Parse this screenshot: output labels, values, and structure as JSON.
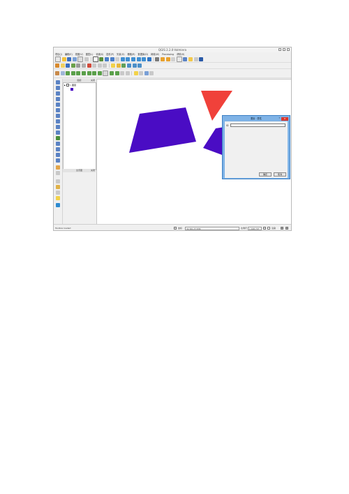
{
  "window": {
    "title": "QGIS 2.2.0-Valmiera"
  },
  "menu": [
    "项目(J)",
    "编辑(E)",
    "视图(V)",
    "图层(L)",
    "设置(S)",
    "插件(P)",
    "矢量(O)",
    "栅格(R)",
    "数据库(D)",
    "网络(W)",
    "Processing",
    "帮助(H)"
  ],
  "layers_panel": {
    "title": "图层",
    "close": "关闭",
    "layer_name": "图层"
  },
  "overview_panel": {
    "title": "全览图",
    "close": "关闭"
  },
  "status": {
    "message": "Toolbox loaded",
    "coord_label": "坐标",
    "coord_value": "32.561,37.836",
    "scale_label": "比例尺",
    "scale_value": "1:168,707",
    "render_label": "渲染"
  },
  "dialog": {
    "title": "要素 · 属性",
    "help": "?",
    "close": "x",
    "field_label": "ID",
    "field_value": "",
    "ok": "确定",
    "cancel": "取消"
  },
  "colors": {
    "polygon_purple": "#4a0cc4",
    "triangle_red": "#f0413a",
    "dialog_frame": "#7fb3e6"
  }
}
